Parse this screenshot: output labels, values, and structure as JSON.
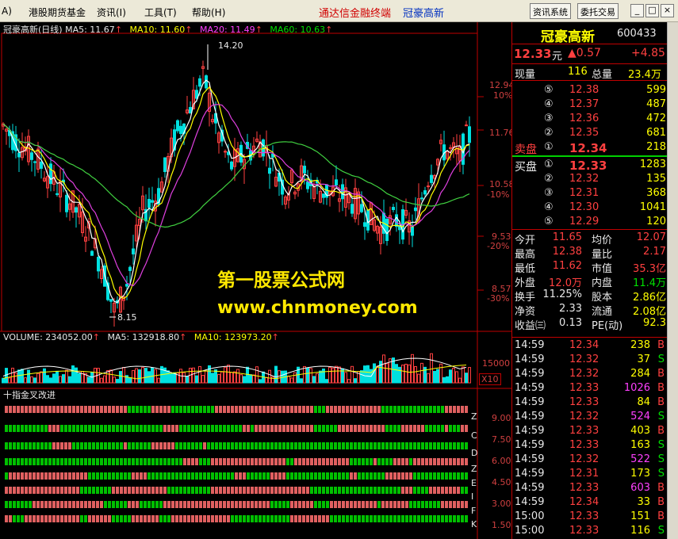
{
  "menu": {
    "app_icon": "A)",
    "items": [
      "港股期货基金",
      "资讯(I)",
      "工具(T)",
      "帮助(H)"
    ],
    "title_left": "通达信金融终端",
    "title_right": "冠豪高新",
    "btn_info": "资讯系统",
    "btn_trade": "委托交易"
  },
  "main_chart": {
    "stock_title": "冠豪高新(日线)",
    "ma5": "MA5: 11.67",
    "ma10": "MA10: 11.60",
    "ma20": "MA20: 11.49",
    "ma60": "MA60: 10.63",
    "high_label": "14.20",
    "low_label": "8.15",
    "axis": [
      {
        "price": "12.94",
        "pct": "10%"
      },
      {
        "price": "11.76",
        "pct": ""
      },
      {
        "price": "10.58",
        "pct": "-10%"
      },
      {
        "price": "9.53",
        "pct": "-20%"
      },
      {
        "price": "8.57",
        "pct": "-30%"
      }
    ]
  },
  "watermark": {
    "line1": "第一股票公式网",
    "line2": "www.chnmoney.com"
  },
  "volume": {
    "label": "VOLUME: 234052.00",
    "ma5": "MA5: 132918.80",
    "ma10": "MA10: 123973.20",
    "axis": "15000",
    "unit": "X10"
  },
  "indicator": {
    "title": "十指金叉改进",
    "letters": [
      "Z",
      "C",
      "D",
      "Z",
      "E",
      "I",
      "F",
      "K"
    ],
    "axis": [
      "9.00",
      "7.50",
      "6.00",
      "4.50",
      "3.00",
      "1.50"
    ]
  },
  "quote": {
    "name": "冠豪高新",
    "code": "600433",
    "price": "12.33",
    "price_unit": "元",
    "change": "▲0.57",
    "change_pct": "+4.85",
    "now_vol_label": "现量",
    "now_vol": "116",
    "total_vol_label": "总量",
    "total_vol": "23.4万",
    "sell_label": "卖盘",
    "buy_label": "买盘",
    "asks": [
      {
        "lvl": "⑤",
        "price": "12.38",
        "vol": "599"
      },
      {
        "lvl": "④",
        "price": "12.37",
        "vol": "487"
      },
      {
        "lvl": "③",
        "price": "12.36",
        "vol": "472"
      },
      {
        "lvl": "②",
        "price": "12.35",
        "vol": "681"
      },
      {
        "lvl": "①",
        "price": "12.34",
        "vol": "218"
      }
    ],
    "bids": [
      {
        "lvl": "①",
        "price": "12.33",
        "vol": "1283"
      },
      {
        "lvl": "②",
        "price": "12.32",
        "vol": "135"
      },
      {
        "lvl": "③",
        "price": "12.31",
        "vol": "368"
      },
      {
        "lvl": "④",
        "price": "12.30",
        "vol": "1041"
      },
      {
        "lvl": "⑤",
        "price": "12.29",
        "vol": "120"
      }
    ],
    "stats": [
      {
        "l1": "今开",
        "v1": "11.65",
        "l2": "均价",
        "v2": "12.07"
      },
      {
        "l1": "最高",
        "v1": "12.38",
        "l2": "量比",
        "v2": "2.17"
      },
      {
        "l1": "最低",
        "v1": "11.62",
        "l2": "市值",
        "v2": "35.3亿"
      },
      {
        "l1": "外盘",
        "v1": "12.0万",
        "l2": "内盘",
        "v2": "11.4万"
      },
      {
        "l1": "换手",
        "v1": "11.25%",
        "l2": "股本",
        "v2": "2.86亿"
      },
      {
        "l1": "净资",
        "v1": "2.33",
        "l2": "流通",
        "v2": "2.08亿"
      },
      {
        "l1": "收益㈢",
        "v1": "0.13",
        "l2": "PE(动)",
        "v2": "92.3"
      }
    ],
    "ticks": [
      {
        "t": "14:59",
        "p": "12.34",
        "v": "238",
        "s": "B"
      },
      {
        "t": "14:59",
        "p": "12.32",
        "v": "37",
        "s": "S"
      },
      {
        "t": "14:59",
        "p": "12.32",
        "v": "284",
        "s": "B"
      },
      {
        "t": "14:59",
        "p": "12.33",
        "v": "1026",
        "s": "B"
      },
      {
        "t": "14:59",
        "p": "12.33",
        "v": "84",
        "s": "B"
      },
      {
        "t": "14:59",
        "p": "12.32",
        "v": "524",
        "s": "S"
      },
      {
        "t": "14:59",
        "p": "12.33",
        "v": "403",
        "s": "B"
      },
      {
        "t": "14:59",
        "p": "12.33",
        "v": "163",
        "s": "S"
      },
      {
        "t": "14:59",
        "p": "12.32",
        "v": "522",
        "s": "S"
      },
      {
        "t": "14:59",
        "p": "12.31",
        "v": "173",
        "s": "S"
      },
      {
        "t": "14:59",
        "p": "12.33",
        "v": "603",
        "s": "B"
      },
      {
        "t": "14:59",
        "p": "12.34",
        "v": "33",
        "s": "B"
      },
      {
        "t": "15:00",
        "p": "12.33",
        "v": "151",
        "s": "B"
      },
      {
        "t": "15:00",
        "p": "12.33",
        "v": "116",
        "s": "S"
      }
    ]
  },
  "colors": {
    "up": "#ff4040",
    "down": "#00e000",
    "cyan": "#00e0e0",
    "ma5": "#ffffff",
    "ma10": "#ffff00",
    "ma20": "#e040e0",
    "ma60": "#40d040"
  }
}
